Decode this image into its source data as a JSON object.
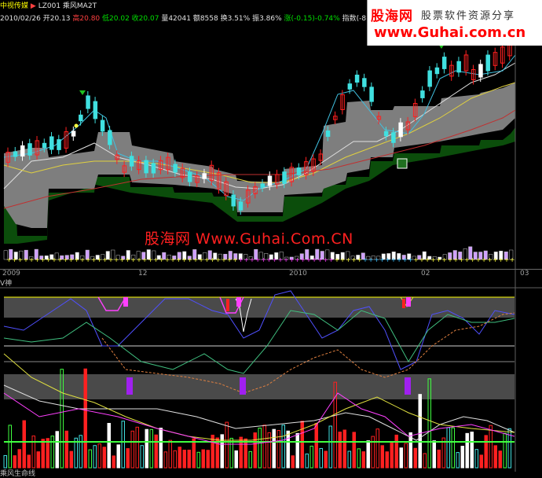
{
  "header": {
    "stock_name": "中视传媒",
    "arrow": "▶",
    "code": "LZ001",
    "formula": "乘风MA2T",
    "row2": {
      "date": "2010/02/26",
      "open_label": "开20.13",
      "high_label": "高20.80",
      "low_label": "低20.02",
      "close_label": "收20.07",
      "volume_label": "量42041",
      "amount_label": "额8558",
      "turnover_label": "换3.51%",
      "amplitude_label": "振3.86%",
      "change_label": "涨(-0.15)-0.74%",
      "index_label": "指数(-8"
    }
  },
  "watermark_top": {
    "brand": "股海网",
    "tagline": "股票软件资源分享",
    "url": "www.Guhai.com.cn"
  },
  "watermark_center": "股海网 Www.Guhai.Com.CN",
  "date_axis": [
    {
      "label": "2009"
    },
    {
      "label": "12"
    },
    {
      "label": "2010"
    },
    {
      "label": "02"
    },
    {
      "label": "03"
    }
  ],
  "indicator_label": "V神",
  "bottom_label": "乘风生命线",
  "colors": {
    "up": "#ff2020",
    "down": "#40e0e0",
    "band_gray": "#8a8a8a",
    "band_green": "#0a4a0a",
    "yellow": "#ffff00",
    "magenta": "#ff40ff",
    "purple": "#a020f0"
  }
}
